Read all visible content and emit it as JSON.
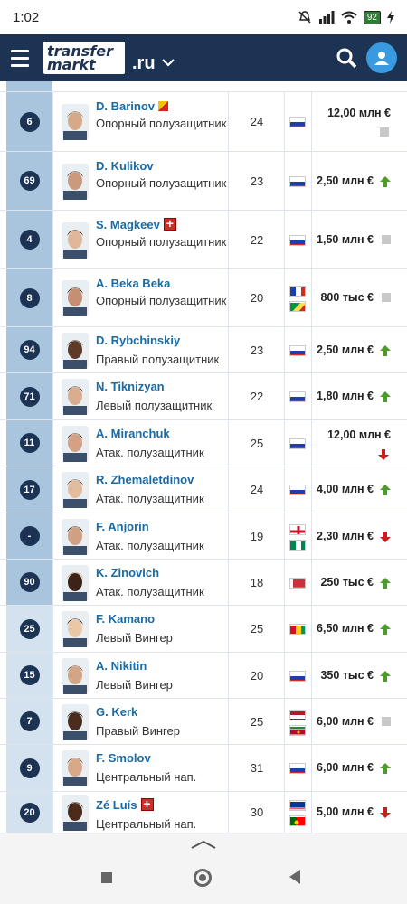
{
  "status": {
    "time": "1:02",
    "battery": "92"
  },
  "header": {
    "logo_line1": "transfer",
    "logo_line2": "markt",
    "domain": ".ru"
  },
  "rows": [
    {
      "num": "6",
      "name": "D. Barinov",
      "pos": "Опорный полузащитник",
      "age": "24",
      "flags": [
        "russia"
      ],
      "value": "12,00 млн €",
      "trend": "flat",
      "badge": "yellow",
      "wrapValue": true
    },
    {
      "num": "69",
      "name": "D. Kulikov",
      "pos": "Опорный полузащитник",
      "age": "23",
      "flags": [
        "russia"
      ],
      "value": "2,50 млн €",
      "trend": "up"
    },
    {
      "num": "4",
      "name": "S. Magkeev",
      "pos": "Опорный полузащитник",
      "age": "22",
      "flags": [
        "russia"
      ],
      "value": "1,50 млн €",
      "trend": "flat",
      "badge": "redcross"
    },
    {
      "num": "8",
      "name": "A. Beka Beka",
      "pos": "Опорный полузащитник",
      "age": "20",
      "flags": [
        "france",
        "congo"
      ],
      "value": "800 тыс €",
      "trend": "flat"
    },
    {
      "num": "94",
      "name": "D. Rybchinskiy",
      "pos": "Правый полузащитник",
      "age": "23",
      "flags": [
        "russia"
      ],
      "value": "2,50 млн €",
      "trend": "up"
    },
    {
      "num": "71",
      "name": "N. Tiknizyan",
      "pos": "Левый полузащитник",
      "age": "22",
      "flags": [
        "russia"
      ],
      "value": "1,80 млн €",
      "trend": "up"
    },
    {
      "num": "11",
      "name": "A. Miranchuk",
      "pos": "Атак. полузащитник",
      "age": "25",
      "flags": [
        "russia"
      ],
      "value": "12,00 млн €",
      "trend": "down",
      "wrapValue": true
    },
    {
      "num": "17",
      "name": "R. Zhemaletdinov",
      "pos": "Атак. полузащитник",
      "age": "24",
      "flags": [
        "russia"
      ],
      "value": "4,00 млн €",
      "trend": "up"
    },
    {
      "num": "-",
      "name": "F. Anjorin",
      "pos": "Атак. полузащитник",
      "age": "19",
      "flags": [
        "england",
        "nigeria"
      ],
      "value": "2,30 млн €",
      "trend": "down"
    },
    {
      "num": "90",
      "name": "K. Zinovich",
      "pos": "Атак. полузащитник",
      "age": "18",
      "flags": [
        "belarus"
      ],
      "value": "250 тыс €",
      "trend": "up"
    },
    {
      "num": "25",
      "name": "F. Kamano",
      "pos": "Левый Вингер",
      "age": "25",
      "flags": [
        "guinea"
      ],
      "value": "6,50 млн €",
      "trend": "up"
    },
    {
      "num": "15",
      "name": "A. Nikitin",
      "pos": "Левый Вингер",
      "age": "20",
      "flags": [
        "russia"
      ],
      "value": "350 тыс €",
      "trend": "up"
    },
    {
      "num": "7",
      "name": "G. Kerk",
      "pos": "Правый Вингер",
      "age": "25",
      "flags": [
        "netherlands",
        "suriname"
      ],
      "value": "6,00 млн €",
      "trend": "flat"
    },
    {
      "num": "9",
      "name": "F. Smolov",
      "pos": "Центральный нап.",
      "age": "31",
      "flags": [
        "russia"
      ],
      "value": "6,00 млн €",
      "trend": "up"
    },
    {
      "num": "20",
      "name": "Zé Luís",
      "pos": "Центральный нап.",
      "age": "30",
      "flags": [
        "capeverde",
        "portugal"
      ],
      "value": "5,00 млн €",
      "trend": "down",
      "badge": "redcross"
    }
  ],
  "colors": {
    "header": "#1d3354",
    "link": "#1a6aa3",
    "up": "#4c9c2a",
    "down": "#cc1d1d",
    "numcell_blue": "#a9c5de",
    "numcell_light": "#d4e1ee"
  }
}
